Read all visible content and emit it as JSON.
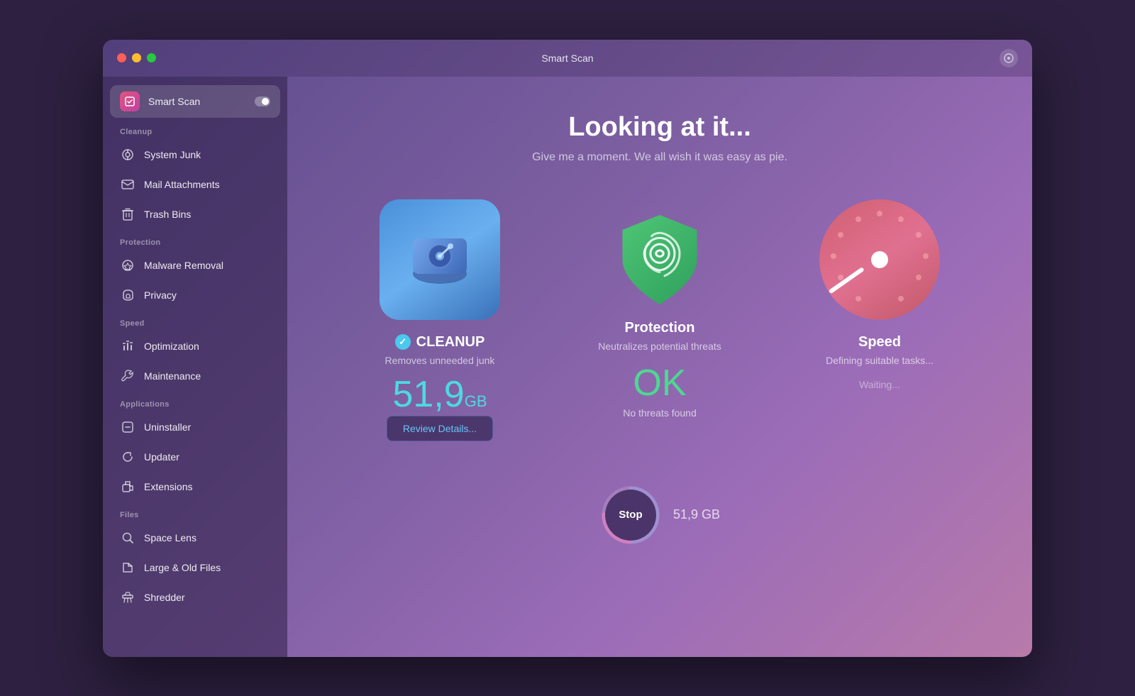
{
  "window": {
    "title": "Smart Scan"
  },
  "sidebar": {
    "active_item": "Smart Scan",
    "active_item_label": "Smart Scan",
    "sections": [
      {
        "name": "cleanup",
        "label": "Cleanup",
        "items": [
          {
            "id": "system-junk",
            "label": "System Junk",
            "icon": "🖥"
          },
          {
            "id": "mail-attachments",
            "label": "Mail Attachments",
            "icon": "✉"
          },
          {
            "id": "trash-bins",
            "label": "Trash Bins",
            "icon": "🗑"
          }
        ]
      },
      {
        "name": "protection",
        "label": "Protection",
        "items": [
          {
            "id": "malware-removal",
            "label": "Malware Removal",
            "icon": "☣"
          },
          {
            "id": "privacy",
            "label": "Privacy",
            "icon": "🤚"
          }
        ]
      },
      {
        "name": "speed",
        "label": "Speed",
        "items": [
          {
            "id": "optimization",
            "label": "Optimization",
            "icon": "⚙"
          },
          {
            "id": "maintenance",
            "label": "Maintenance",
            "icon": "🔧"
          }
        ]
      },
      {
        "name": "applications",
        "label": "Applications",
        "items": [
          {
            "id": "uninstaller",
            "label": "Uninstaller",
            "icon": "📦"
          },
          {
            "id": "updater",
            "label": "Updater",
            "icon": "🔄"
          },
          {
            "id": "extensions",
            "label": "Extensions",
            "icon": "🧩"
          }
        ]
      },
      {
        "name": "files",
        "label": "Files",
        "items": [
          {
            "id": "space-lens",
            "label": "Space Lens",
            "icon": "🔍"
          },
          {
            "id": "large-old-files",
            "label": "Large & Old Files",
            "icon": "📁"
          },
          {
            "id": "shredder",
            "label": "Shredder",
            "icon": "🗂"
          }
        ]
      }
    ]
  },
  "main": {
    "title": "Looking at it...",
    "subtitle": "Give me a moment. We all wish it was easy as pie.",
    "cards": [
      {
        "id": "cleanup",
        "title": "CLEANUP",
        "desc": "Removes unneeded junk",
        "value": "51,9",
        "value_unit": "GB",
        "action_label": "Review Details...",
        "has_check": true
      },
      {
        "id": "protection",
        "title": "Protection",
        "desc": "Neutralizes potential threats",
        "status_value": "OK",
        "status_text": "No threats found",
        "has_check": false
      },
      {
        "id": "speed",
        "title": "Speed",
        "desc": "Defining suitable tasks...",
        "waiting_text": "Waiting...",
        "has_check": false
      }
    ],
    "stop_button": {
      "label": "Stop",
      "size_text": "51,9 GB"
    }
  }
}
